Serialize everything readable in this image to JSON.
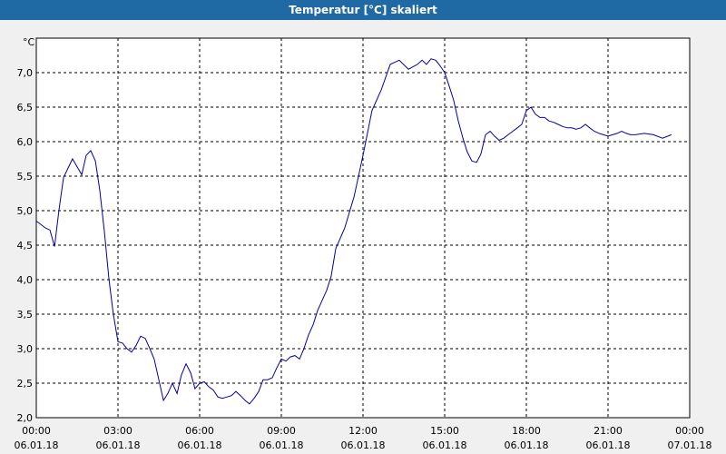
{
  "window": {
    "title": "Temperatur [°C] skaliert"
  },
  "colors": {
    "titlebar": "#1f6aa5",
    "line": "#0000a0",
    "background": "#ffffff",
    "grid": "#000000"
  },
  "chart_data": {
    "type": "line",
    "title": "Temperatur [°C] skaliert",
    "ylabel": "°C",
    "xlabel": "",
    "ylim": [
      2.0,
      7.5
    ],
    "xlim": [
      0,
      24
    ],
    "grid": true,
    "yticks": [
      "2,0",
      "2,5",
      "3,0",
      "3,5",
      "4,0",
      "4,5",
      "5,0",
      "5,5",
      "6,0",
      "6,5",
      "7,0"
    ],
    "xticks": [
      {
        "time": "00:00",
        "date": "06.01.18"
      },
      {
        "time": "03:00",
        "date": "06.01.18"
      },
      {
        "time": "06:00",
        "date": "06.01.18"
      },
      {
        "time": "09:00",
        "date": "06.01.18"
      },
      {
        "time": "12:00",
        "date": "06.01.18"
      },
      {
        "time": "15:00",
        "date": "06.01.18"
      },
      {
        "time": "18:00",
        "date": "06.01.18"
      },
      {
        "time": "21:00",
        "date": "06.01.18"
      },
      {
        "time": "00:00",
        "date": "07.01.18"
      }
    ],
    "series": [
      {
        "x_hours": [
          0,
          0.33,
          0.5,
          0.67,
          0.83,
          1.0,
          1.33,
          1.67,
          1.83,
          2.0,
          2.17,
          2.33,
          2.5,
          2.67,
          2.83,
          3.0,
          3.17,
          3.33,
          3.5,
          3.67,
          3.83,
          4.0,
          4.17,
          4.33,
          4.5,
          4.67,
          4.83,
          5.0,
          5.17,
          5.33,
          5.5,
          5.67,
          5.83,
          6.0,
          6.17,
          6.33,
          6.5,
          6.67,
          6.83,
          7.0,
          7.17,
          7.33,
          7.5,
          7.67,
          7.83,
          8.0,
          8.17,
          8.33,
          8.5,
          8.67,
          8.83,
          9.0,
          9.17,
          9.33,
          9.5,
          9.67,
          9.83,
          10.0,
          10.17,
          10.33,
          10.5,
          10.67,
          10.83,
          11.0,
          11.33,
          11.67,
          12.0,
          12.33,
          12.67,
          13.0,
          13.33,
          13.67,
          14.0,
          14.17,
          14.33,
          14.5,
          14.67,
          14.83,
          15.0,
          15.17,
          15.33,
          15.5,
          15.67,
          15.83,
          16.0,
          16.17,
          16.33,
          16.5,
          16.67,
          16.83,
          17.0,
          17.17,
          17.33,
          17.5,
          17.67,
          17.83,
          18.0,
          18.17,
          18.33,
          18.5,
          18.67,
          18.83,
          19.0,
          19.17,
          19.33,
          19.5,
          19.67,
          19.83,
          20.0,
          20.17,
          20.33,
          20.5,
          20.67,
          20.83,
          21.0,
          21.17,
          21.33,
          21.5,
          21.67,
          21.83,
          22.0,
          22.33,
          22.67,
          23.0,
          23.33,
          23.67
        ],
        "values": [
          4.85,
          4.75,
          4.72,
          4.48,
          5.0,
          5.48,
          5.75,
          5.52,
          5.8,
          5.87,
          5.72,
          5.3,
          4.7,
          4.0,
          3.5,
          3.1,
          3.08,
          3.0,
          2.95,
          3.05,
          3.18,
          3.15,
          3.0,
          2.85,
          2.55,
          2.25,
          2.35,
          2.5,
          2.35,
          2.62,
          2.78,
          2.65,
          2.42,
          2.5,
          2.52,
          2.45,
          2.4,
          2.3,
          2.28,
          2.3,
          2.32,
          2.38,
          2.32,
          2.25,
          2.2,
          2.28,
          2.38,
          2.55,
          2.55,
          2.58,
          2.72,
          2.85,
          2.82,
          2.88,
          2.9,
          2.85,
          3.0,
          3.2,
          3.35,
          3.55,
          3.7,
          3.85,
          4.05,
          4.45,
          4.75,
          5.2,
          5.8,
          6.45,
          6.75,
          7.12,
          7.18,
          7.05,
          7.12,
          7.18,
          7.12,
          7.2,
          7.18,
          7.1,
          7.0,
          6.8,
          6.6,
          6.3,
          6.05,
          5.85,
          5.72,
          5.7,
          5.82,
          6.1,
          6.15,
          6.08,
          6.02,
          6.05,
          6.1,
          6.15,
          6.2,
          6.25,
          6.45,
          6.5,
          6.4,
          6.35,
          6.35,
          6.3,
          6.28,
          6.25,
          6.22,
          6.2,
          6.2,
          6.18,
          6.2,
          6.25,
          6.2,
          6.15,
          6.12,
          6.1,
          6.08,
          6.1,
          6.12,
          6.15,
          6.12,
          6.1,
          6.1,
          6.12,
          6.1,
          6.05,
          6.1
        ]
      }
    ]
  }
}
